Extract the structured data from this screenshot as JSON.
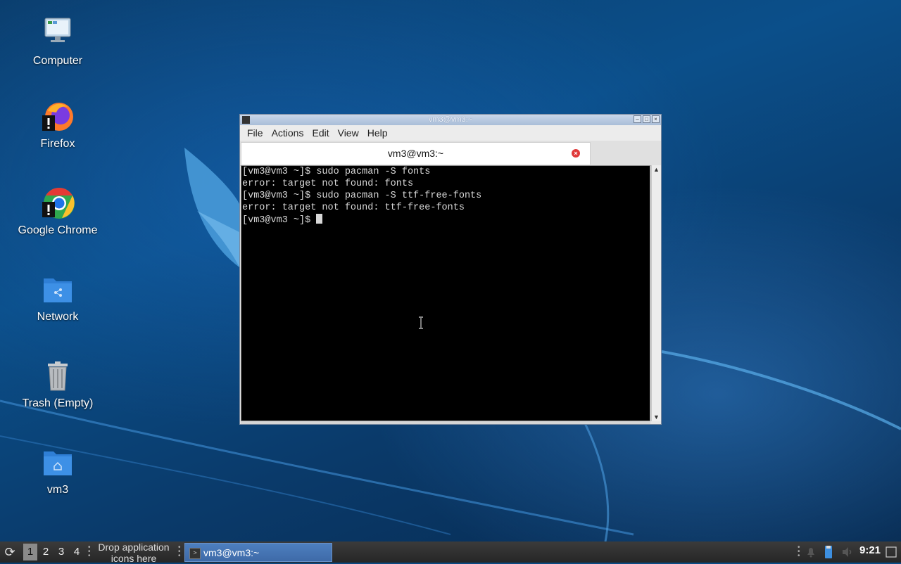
{
  "desktop": {
    "icons": [
      {
        "label": "Computer"
      },
      {
        "label": "Firefox"
      },
      {
        "label": "Google Chrome"
      },
      {
        "label": "Network"
      },
      {
        "label": "Trash (Empty)"
      },
      {
        "label": "vm3"
      }
    ]
  },
  "window": {
    "title": "vm3@vm3:~",
    "menu": [
      "File",
      "Actions",
      "Edit",
      "View",
      "Help"
    ],
    "tab_label": "vm3@vm3:~",
    "terminal_lines": [
      "[vm3@vm3 ~]$ sudo pacman -S fonts",
      "error: target not found: fonts",
      "[vm3@vm3 ~]$ sudo pacman -S ttf-free-fonts",
      "error: target not found: ttf-free-fonts",
      "[vm3@vm3 ~]$ "
    ]
  },
  "taskbar": {
    "workspaces": [
      "1",
      "2",
      "3",
      "4"
    ],
    "drop_hint": "Drop application icons here",
    "task_label": "vm3@vm3:~",
    "clock": "9:21"
  },
  "colors": {
    "terminal_bg": "#000000",
    "terminal_fg": "#d8d8d8",
    "task_active": "#4d7fbf"
  }
}
